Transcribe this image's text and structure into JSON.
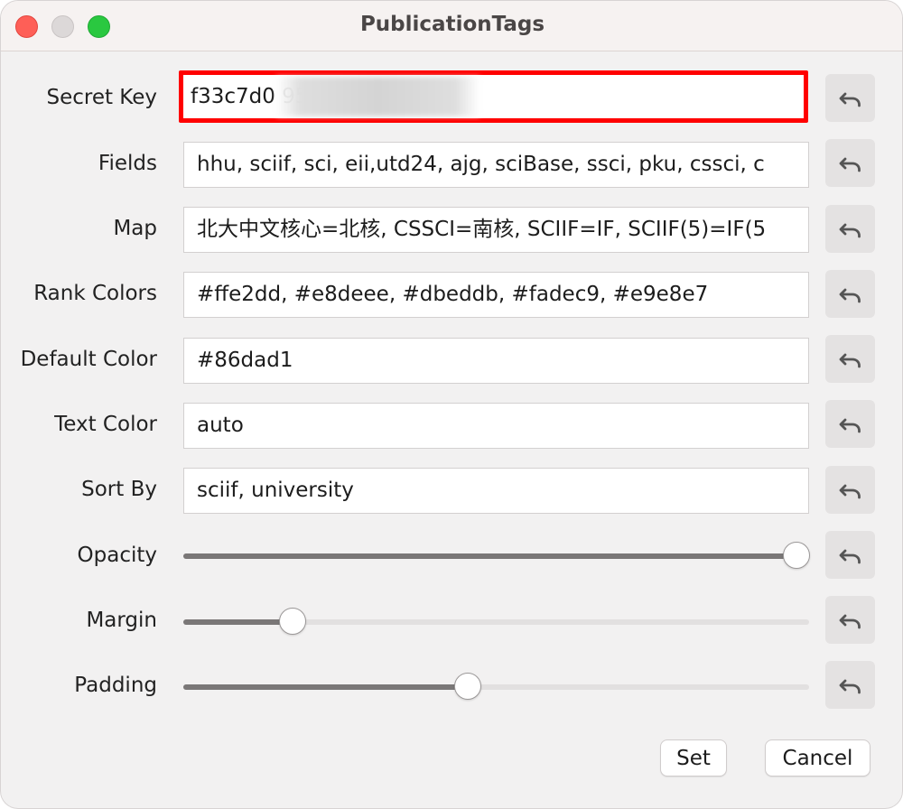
{
  "window": {
    "title": "PublicationTags"
  },
  "colors": {
    "focus_ring": "#ff0000",
    "slider_fill": "#7a7777"
  },
  "icons": {
    "revert": "undo-arrow-icon"
  },
  "rows": [
    {
      "label": "Secret Key",
      "value": "f33c7d0                    955d8a56a3"
    },
    {
      "label": "Fields",
      "value": "hhu, sciif, sci, eii,utd24, ajg, sciBase, ssci, pku, cssci, c"
    },
    {
      "label": "Map",
      "value": "北大中文核心=北核, CSSCI=南核, SCIIF=IF, SCIIF(5)=IF(5"
    },
    {
      "label": "Rank Colors",
      "value": "#ffe2dd, #e8deee, #dbeddb, #fadec9, #e9e8e7"
    },
    {
      "label": "Default Color",
      "value": "#86dad1"
    },
    {
      "label": "Text Color",
      "value": "auto"
    },
    {
      "label": "Sort By",
      "value": "sciif, university"
    }
  ],
  "sliders": [
    {
      "label": "Opacity",
      "fraction": 0.98
    },
    {
      "label": "Margin",
      "fraction": 0.175
    },
    {
      "label": "Padding",
      "fraction": 0.455
    }
  ],
  "buttons": {
    "set": "Set",
    "cancel": "Cancel"
  }
}
